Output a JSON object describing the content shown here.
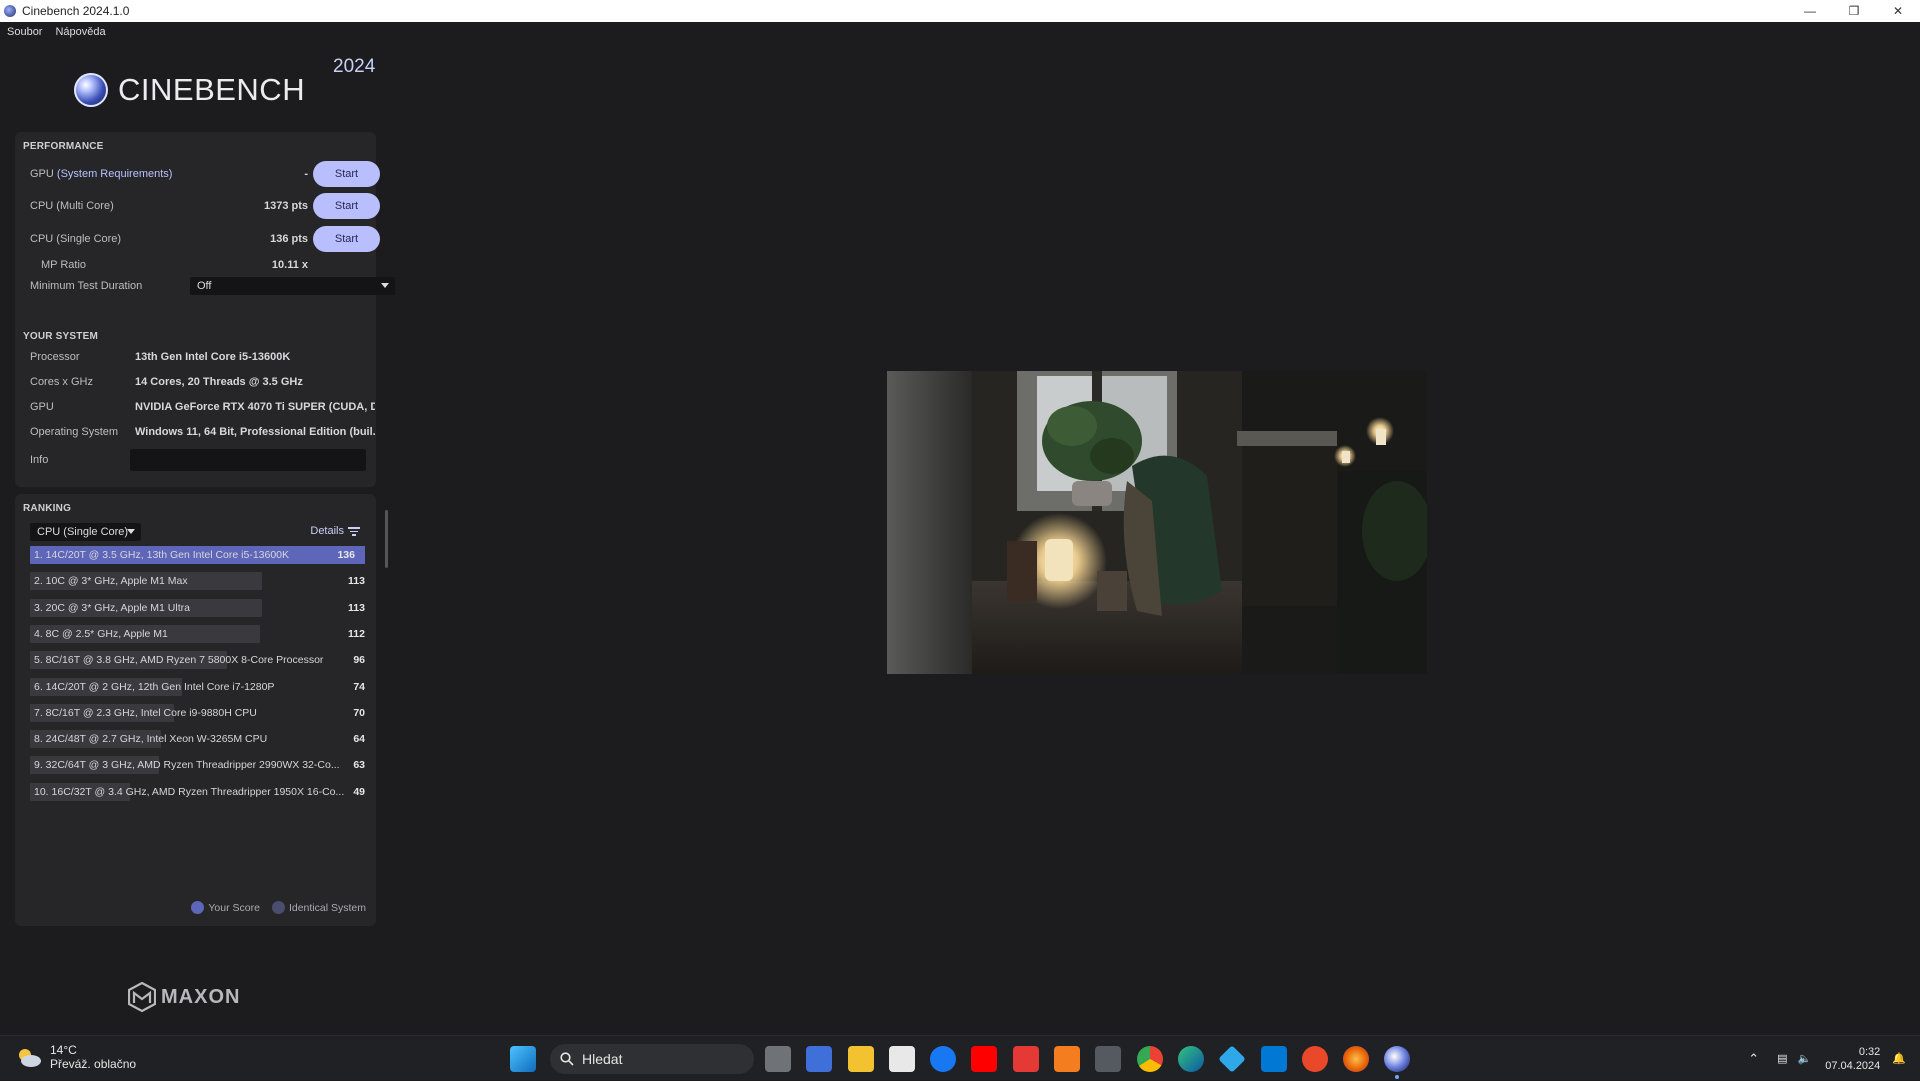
{
  "window": {
    "title": "Cinebench 2024.1.0"
  },
  "menu": [
    "Soubor",
    "Nápověda"
  ],
  "logo": {
    "name": "CINEBENCH",
    "year": "2024"
  },
  "performance": {
    "header": "PERFORMANCE",
    "gpu_label": "GPU",
    "gpu_link": "(System Requirements)",
    "gpu_value": "-",
    "cpu_multi_label": "CPU (Multi Core)",
    "cpu_multi_value": "1373 pts",
    "cpu_single_label": "CPU (Single Core)",
    "cpu_single_value": "136 pts",
    "mp_ratio_label": "MP Ratio",
    "mp_ratio_value": "10.11 x",
    "min_duration_label": "Minimum Test Duration",
    "min_duration_value": "Off",
    "start_label": "Start"
  },
  "your_system": {
    "header": "YOUR SYSTEM",
    "rows": [
      {
        "k": "Processor",
        "v": "13th Gen Intel Core i5-13600K"
      },
      {
        "k": "Cores x GHz",
        "v": "14 Cores, 20 Threads @ 3.5 GHz"
      },
      {
        "k": "GPU",
        "v": "NVIDIA GeForce RTX 4070 Ti SUPER (CUDA, D..."
      },
      {
        "k": "Operating System",
        "v": "Windows 11, 64 Bit, Professional Edition (buil..."
      }
    ],
    "info_label": "Info"
  },
  "ranking": {
    "header": "RANKING",
    "dropdown": "CPU (Single Core)",
    "details": "Details",
    "rows": [
      {
        "label": "1. 14C/20T @ 3.5 GHz, 13th Gen Intel Core i5-13600K",
        "score": "136",
        "frac": 1.0
      },
      {
        "label": "2. 10C @ 3* GHz, Apple M1 Max",
        "score": "113",
        "frac": 0.831
      },
      {
        "label": "3. 20C @ 3* GHz, Apple M1 Ultra",
        "score": "113",
        "frac": 0.831
      },
      {
        "label": "4. 8C @ 2.5* GHz, Apple M1",
        "score": "112",
        "frac": 0.824
      },
      {
        "label": "5. 8C/16T @ 3.8 GHz, AMD Ryzen 7 5800X 8-Core Processor",
        "score": "96",
        "frac": 0.706
      },
      {
        "label": "6. 14C/20T @ 2 GHz, 12th Gen Intel Core i7-1280P",
        "score": "74",
        "frac": 0.544
      },
      {
        "label": "7. 8C/16T @ 2.3 GHz, Intel Core i9-9880H CPU",
        "score": "70",
        "frac": 0.515
      },
      {
        "label": "8. 24C/48T @ 2.7 GHz, Intel Xeon W-3265M CPU",
        "score": "64",
        "frac": 0.471
      },
      {
        "label": "9. 32C/64T @ 3 GHz, AMD Ryzen Threadripper 2990WX 32-Co...",
        "score": "63",
        "frac": 0.463
      },
      {
        "label": "10. 16C/32T @ 3.4 GHz, AMD Ryzen Threadripper 1950X 16-Co...",
        "score": "49",
        "frac": 0.36
      }
    ],
    "legend_your": "Your Score",
    "legend_identical": "Identical System"
  },
  "brand": "MAXON",
  "taskbar": {
    "temperature": "14°C",
    "weather": "Převáž. oblačno",
    "search": "Hledat",
    "time": "0:32",
    "date": "07.04.2024"
  },
  "colors": {
    "accent": "#b9bffc",
    "your_score": "#5d66b8",
    "identical": "#4a4d6e"
  }
}
